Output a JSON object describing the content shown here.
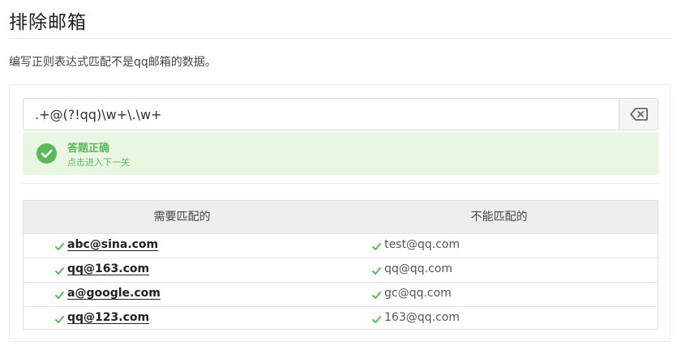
{
  "page": {
    "title": "排除邮箱",
    "instruction": "编写正则表达式匹配不是qq邮箱的数据。"
  },
  "regex": {
    "value": ".+@(?!qq)\\w+\\.\\w+",
    "clear_icon": "backspace-clear-icon"
  },
  "result": {
    "title": "答题正确",
    "subtitle": "点击进入下一关",
    "icon": "check-circle-icon",
    "color": "#5cb85c"
  },
  "table": {
    "headers": [
      "需要匹配的",
      "不能匹配的"
    ],
    "rows": [
      {
        "match": "abc@sina.com",
        "nomatch": "test@qq.com"
      },
      {
        "match": "qq@163.com",
        "nomatch": "qq@qq.com"
      },
      {
        "match": "a@google.com",
        "nomatch": "gc@qq.com"
      },
      {
        "match": "qq@123.com",
        "nomatch": "163@qq.com"
      }
    ]
  }
}
